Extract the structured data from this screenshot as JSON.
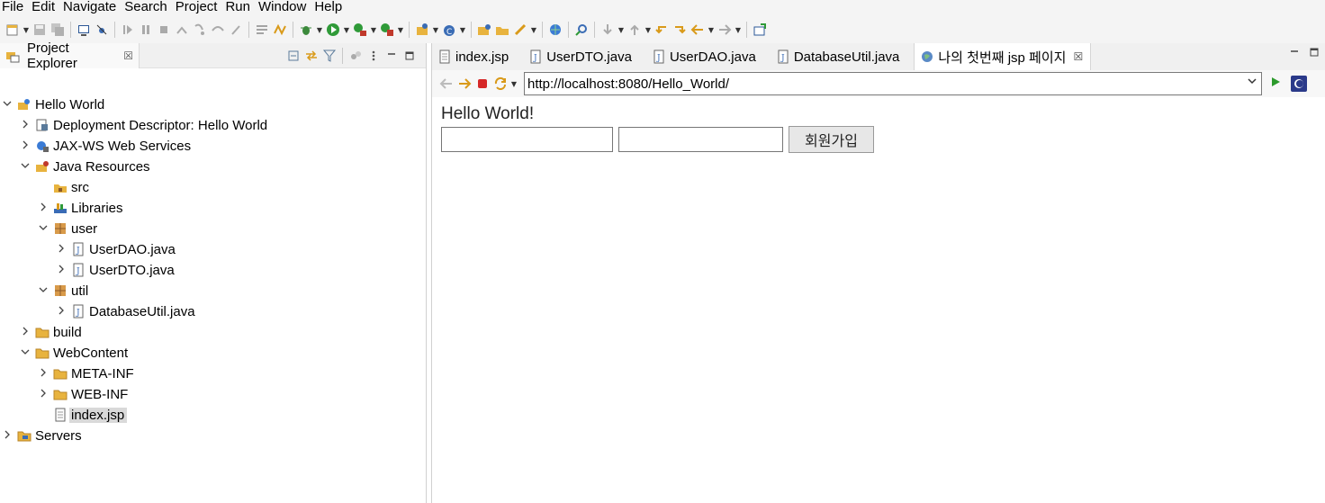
{
  "menu": [
    "File",
    "Edit",
    "Navigate",
    "Search",
    "Project",
    "Run",
    "Window",
    "Help"
  ],
  "explorer": {
    "title": "Project Explorer",
    "close": "☒",
    "tree": [
      {
        "label": "Hello World",
        "depth": 0,
        "expanded": true,
        "icon": "project-icon"
      },
      {
        "label": "Deployment Descriptor: Hello World",
        "depth": 1,
        "expanded": false,
        "icon": "deployment-descriptor-icon"
      },
      {
        "label": "JAX-WS Web Services",
        "depth": 1,
        "expanded": false,
        "icon": "web-services-icon"
      },
      {
        "label": "Java Resources",
        "depth": 1,
        "expanded": true,
        "icon": "java-resources-icon"
      },
      {
        "label": "src",
        "depth": 2,
        "expanded": null,
        "icon": "source-folder-icon"
      },
      {
        "label": "Libraries",
        "depth": 2,
        "expanded": false,
        "icon": "libraries-icon"
      },
      {
        "label": "user",
        "depth": 2,
        "expanded": true,
        "icon": "package-icon"
      },
      {
        "label": "UserDAO.java",
        "depth": 3,
        "expanded": false,
        "icon": "java-file-icon"
      },
      {
        "label": "UserDTO.java",
        "depth": 3,
        "expanded": false,
        "icon": "java-file-icon"
      },
      {
        "label": "util",
        "depth": 2,
        "expanded": true,
        "icon": "package-icon"
      },
      {
        "label": "DatabaseUtil.java",
        "depth": 3,
        "expanded": false,
        "icon": "java-file-icon"
      },
      {
        "label": "build",
        "depth": 1,
        "expanded": false,
        "icon": "folder-icon"
      },
      {
        "label": "WebContent",
        "depth": 1,
        "expanded": true,
        "icon": "folder-icon"
      },
      {
        "label": "META-INF",
        "depth": 2,
        "expanded": false,
        "icon": "folder-icon"
      },
      {
        "label": "WEB-INF",
        "depth": 2,
        "expanded": false,
        "icon": "folder-icon"
      },
      {
        "label": "index.jsp",
        "depth": 2,
        "expanded": null,
        "icon": "jsp-file-icon",
        "selected": true
      },
      {
        "label": "Servers",
        "depth": 0,
        "expanded": false,
        "icon": "servers-folder-icon"
      }
    ]
  },
  "editor_tabs": [
    {
      "label": "index.jsp",
      "icon": "jsp-file-icon"
    },
    {
      "label": "UserDTO.java",
      "icon": "java-file-icon"
    },
    {
      "label": "UserDAO.java",
      "icon": "java-file-icon"
    },
    {
      "label": "DatabaseUtil.java",
      "icon": "java-file-icon"
    },
    {
      "label": "나의 첫번째 jsp 페이지",
      "icon": "globe-icon",
      "active": true
    }
  ],
  "browser": {
    "url": "http://localhost:8080/Hello_World/",
    "heading": "Hello World!",
    "submit_label": "회원가입"
  },
  "colors": {
    "selection": "#d9d9d9",
    "chrome": "#f0f0f0",
    "go": "#2c9a2c"
  }
}
